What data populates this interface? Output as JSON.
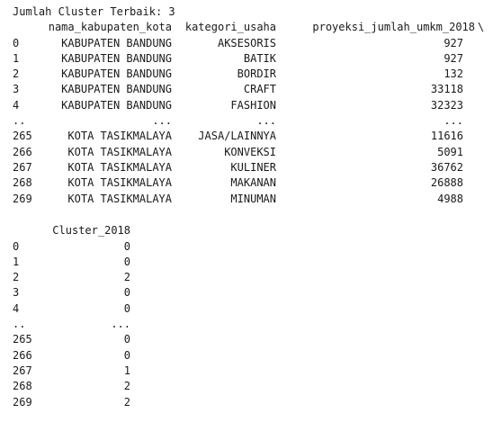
{
  "output": {
    "heading": "Jumlah Cluster Terbaik: 3",
    "table1": {
      "columns": [
        "nama_kabupaten_kota",
        "kategori_usaha",
        "proyeksi_jumlah_umkm_2018"
      ],
      "continuation": "\\",
      "rows": [
        {
          "index": "0",
          "kota": "KABUPATEN BANDUNG",
          "kategori": "AKSESORIS",
          "proyeksi": "927"
        },
        {
          "index": "1",
          "kota": "KABUPATEN BANDUNG",
          "kategori": "BATIK",
          "proyeksi": "927"
        },
        {
          "index": "2",
          "kota": "KABUPATEN BANDUNG",
          "kategori": "BORDIR",
          "proyeksi": "132"
        },
        {
          "index": "3",
          "kota": "KABUPATEN BANDUNG",
          "kategori": "CRAFT",
          "proyeksi": "33118"
        },
        {
          "index": "4",
          "kota": "KABUPATEN BANDUNG",
          "kategori": "FASHION",
          "proyeksi": "32323"
        },
        {
          "index": "..",
          "kota": "...",
          "kategori": "...",
          "proyeksi": "..."
        },
        {
          "index": "265",
          "kota": "KOTA TASIKMALAYA",
          "kategori": "JASA/LAINNYA",
          "proyeksi": "11616"
        },
        {
          "index": "266",
          "kota": "KOTA TASIKMALAYA",
          "kategori": "KONVEKSI",
          "proyeksi": "5091"
        },
        {
          "index": "267",
          "kota": "KOTA TASIKMALAYA",
          "kategori": "KULINER",
          "proyeksi": "36762"
        },
        {
          "index": "268",
          "kota": "KOTA TASIKMALAYA",
          "kategori": "MAKANAN",
          "proyeksi": "26888"
        },
        {
          "index": "269",
          "kota": "KOTA TASIKMALAYA",
          "kategori": "MINUMAN",
          "proyeksi": "4988"
        }
      ]
    },
    "table2": {
      "column": "Cluster_2018",
      "rows": [
        {
          "index": "0",
          "cluster": "0"
        },
        {
          "index": "1",
          "cluster": "0"
        },
        {
          "index": "2",
          "cluster": "2"
        },
        {
          "index": "3",
          "cluster": "0"
        },
        {
          "index": "4",
          "cluster": "0"
        },
        {
          "index": "..",
          "cluster": "..."
        },
        {
          "index": "265",
          "cluster": "0"
        },
        {
          "index": "266",
          "cluster": "0"
        },
        {
          "index": "267",
          "cluster": "1"
        },
        {
          "index": "268",
          "cluster": "2"
        },
        {
          "index": "269",
          "cluster": "2"
        }
      ]
    }
  }
}
